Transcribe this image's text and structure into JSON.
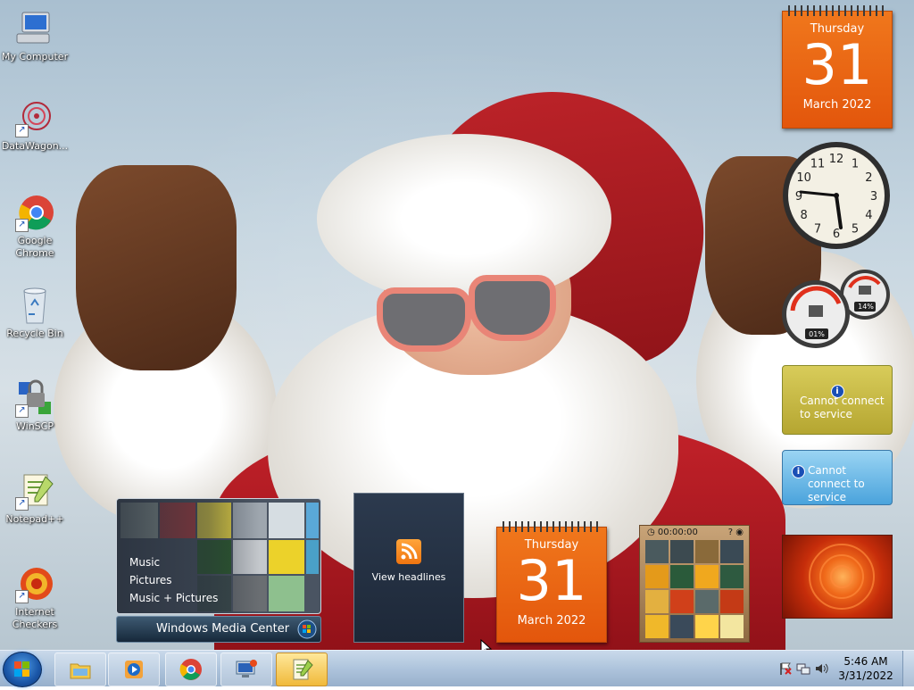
{
  "desktop_icons": [
    {
      "name": "my-computer",
      "label": "My Computer",
      "shortcut": false
    },
    {
      "name": "datawagon",
      "label": "DataWagon...",
      "shortcut": true
    },
    {
      "name": "google-chrome",
      "label": "Google Chrome",
      "shortcut": true
    },
    {
      "name": "recycle-bin",
      "label": "Recycle Bin",
      "shortcut": false
    },
    {
      "name": "winscp",
      "label": "WinSCP",
      "shortcut": true
    },
    {
      "name": "notepad-plus-plus",
      "label": "Notepad++",
      "shortcut": true
    },
    {
      "name": "internet-checkers",
      "label": "Internet Checkers",
      "shortcut": true
    }
  ],
  "gadgets": {
    "calendar_top": {
      "day": "Thursday",
      "date": "31",
      "month": "March 2022"
    },
    "calendar_bottom": {
      "day": "Thursday",
      "date": "31",
      "month": "March 2022"
    },
    "clock": {
      "numerals": [
        "12",
        "1",
        "2",
        "3",
        "4",
        "5",
        "6",
        "7",
        "8",
        "9",
        "10",
        "11"
      ],
      "time": "5:46"
    },
    "cpu_meter": {
      "cpu": "01%",
      "memory": "14%"
    },
    "currency": {
      "message": "Cannot connect to service"
    },
    "stocks": {
      "message": "Cannot connect to service"
    },
    "feed_headlines": {
      "label": "View headlines"
    },
    "puzzle": {
      "timer": "00:00:00"
    },
    "media_center": {
      "items": [
        "Music",
        "Pictures",
        "Music + Pictures"
      ],
      "brand": "Windows Media Center"
    }
  },
  "taskbar": {
    "pinned": [
      "Windows Explorer",
      "Windows Media Player",
      "Google Chrome",
      "Remote Desktop Connection",
      "Notepad++"
    ],
    "active_index": 4,
    "clock_time": "5:46 AM",
    "clock_date": "3/31/2022"
  },
  "colors": {
    "calendar_orange": "#e8620f",
    "taskbar": "#aec4dc",
    "start_orb": "#1a56a8"
  }
}
